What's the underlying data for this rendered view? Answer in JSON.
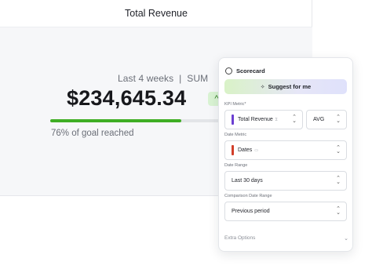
{
  "card": {
    "title": "Total Revenue",
    "period": "Last 4 weeks",
    "aggregation": "SUM",
    "value": "$234,645.34",
    "trend_symbol": "^",
    "goal_text": "76% of goal reached",
    "goal_fraction": 0.76,
    "progress_color": "#3fae25"
  },
  "panel": {
    "title": "Scorecard",
    "suggest_label": "Suggest for me",
    "kpi_label": "KPI Metric*",
    "kpi_value": "Total Revenue",
    "kpi_tag": "Σ",
    "kpi_tag_color": "#6b3fd1",
    "agg_value": "AVG",
    "date_metric_label": "Date Metric",
    "date_metric_value": "Dates",
    "date_metric_tag": "▭",
    "date_metric_tag_color": "#d13f2a",
    "date_range_label": "Date Range",
    "date_range_value": "Last 30 days",
    "comparison_label": "Comparison Date Range",
    "comparison_value": "Previous period",
    "extra_options_label": "Extra Options"
  }
}
